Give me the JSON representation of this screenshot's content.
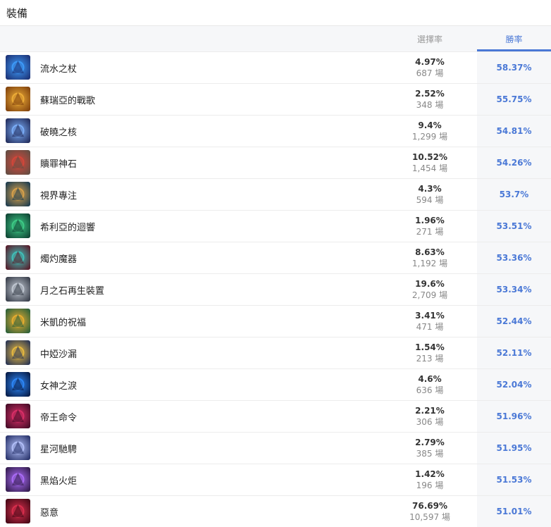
{
  "section": {
    "title": "裝備"
  },
  "table": {
    "columns": {
      "pick_rate": "選擇率",
      "win_rate": "勝率"
    },
    "rows": [
      {
        "name": "流水之杖",
        "pick_rate": "4.97%",
        "games": "687 場",
        "win_rate": "58.37%",
        "icon": "flowing-water-staff-icon",
        "colors": [
          "#1a2a6c",
          "#3fa0ff"
        ]
      },
      {
        "name": "蘇瑞亞的戰歌",
        "pick_rate": "2.52%",
        "games": "348 場",
        "win_rate": "55.75%",
        "icon": "shurelyas-battlesong-icon",
        "colors": [
          "#7a3b0a",
          "#f2b23a"
        ]
      },
      {
        "name": "破曉之核",
        "pick_rate": "9.4%",
        "games": "1,299 場",
        "win_rate": "54.81%",
        "icon": "dawncore-icon",
        "colors": [
          "#1c2350",
          "#7fb4ff"
        ]
      },
      {
        "name": "贖罪神石",
        "pick_rate": "10.52%",
        "games": "1,454 場",
        "win_rate": "54.26%",
        "icon": "redemption-icon",
        "colors": [
          "#5a4e44",
          "#d8463a"
        ]
      },
      {
        "name": "視界專注",
        "pick_rate": "4.3%",
        "games": "594 場",
        "win_rate": "53.7%",
        "icon": "staff-of-flowing-focus-icon",
        "colors": [
          "#0f3550",
          "#e0a64a"
        ]
      },
      {
        "name": "希利亞的迴響",
        "pick_rate": "1.96%",
        "games": "271 場",
        "win_rate": "53.51%",
        "icon": "echoes-of-helia-icon",
        "colors": [
          "#0c3a2e",
          "#3fd18a"
        ]
      },
      {
        "name": "燭灼魔器",
        "pick_rate": "8.63%",
        "games": "1,192 場",
        "win_rate": "53.36%",
        "icon": "rylais-icon",
        "colors": [
          "#5a0e1e",
          "#3fc8c0"
        ]
      },
      {
        "name": "月之石再生裝置",
        "pick_rate": "19.6%",
        "games": "2,709 場",
        "win_rate": "53.34%",
        "icon": "moonstone-renewer-icon",
        "colors": [
          "#2e3440",
          "#c7ced8"
        ]
      },
      {
        "name": "米凱的祝福",
        "pick_rate": "3.41%",
        "games": "471 場",
        "win_rate": "52.44%",
        "icon": "mikaels-blessing-icon",
        "colors": [
          "#1d5a3a",
          "#f0b030"
        ]
      },
      {
        "name": "中婭沙漏",
        "pick_rate": "1.54%",
        "games": "213 場",
        "win_rate": "52.11%",
        "icon": "zhonyas-hourglass-icon",
        "colors": [
          "#1a2a55",
          "#f0c040"
        ]
      },
      {
        "name": "女神之淚",
        "pick_rate": "4.6%",
        "games": "636 場",
        "win_rate": "52.04%",
        "icon": "tear-of-the-goddess-icon",
        "colors": [
          "#05143a",
          "#2f8cff"
        ]
      },
      {
        "name": "帝王命令",
        "pick_rate": "2.21%",
        "games": "306 場",
        "win_rate": "51.96%",
        "icon": "imperial-mandate-icon",
        "colors": [
          "#3a0a22",
          "#e0306a"
        ]
      },
      {
        "name": "星河馳騁",
        "pick_rate": "2.79%",
        "games": "385 場",
        "win_rate": "51.95%",
        "icon": "celestial-opposition-icon",
        "colors": [
          "#1e2860",
          "#b8c6ff"
        ]
      },
      {
        "name": "黑焰火炬",
        "pick_rate": "1.42%",
        "games": "196 場",
        "win_rate": "51.53%",
        "icon": "blackfire-torch-icon",
        "colors": [
          "#2a1640",
          "#b070ff"
        ]
      },
      {
        "name": "惡意",
        "pick_rate": "76.69%",
        "games": "10,597 場",
        "win_rate": "51.01%",
        "icon": "malignance-icon",
        "colors": [
          "#3a0612",
          "#e03050"
        ]
      }
    ]
  }
}
